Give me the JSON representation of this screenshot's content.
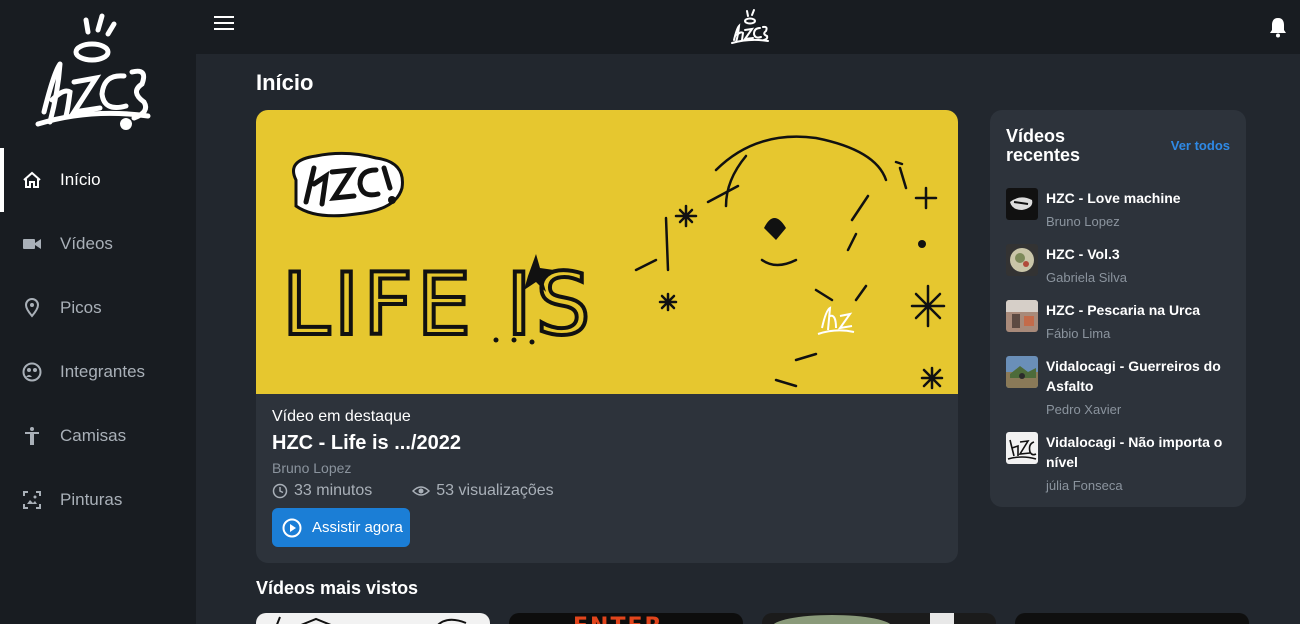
{
  "nav": {
    "items": [
      {
        "label": "Início",
        "icon": "home-icon"
      },
      {
        "label": "Vídeos",
        "icon": "video-camera-icon"
      },
      {
        "label": "Picos",
        "icon": "map-pin-icon"
      },
      {
        "label": "Integrantes",
        "icon": "group-icon"
      },
      {
        "label": "Camisas",
        "icon": "person-icon"
      },
      {
        "label": "Pinturas",
        "icon": "image-icon"
      }
    ]
  },
  "main": {
    "title": "Início",
    "featured": {
      "kicker": "Vídeo em destaque",
      "title": "HZC - Life is .../2022",
      "author": "Bruno Lopez",
      "duration": "33 minutos",
      "views": "53 visualizações",
      "cta": "Assistir agora",
      "art_text": "LIFE IS"
    },
    "recent": {
      "title": "Vídeos recentes",
      "see_all": "Ver todos",
      "items": [
        {
          "title": "HZC - Love machine",
          "author": "Bruno Lopez"
        },
        {
          "title": "HZC - Vol.3",
          "author": "Gabriela Silva"
        },
        {
          "title": "HZC - Pescaria na Urca",
          "author": "Fábio Lima"
        },
        {
          "title": "Vidalocagi - Guerreiros do Asfalto",
          "author": "Pedro Xavier"
        },
        {
          "title": "Vidalocagi - Não importa o nível",
          "author": "júlia Fonseca"
        }
      ]
    },
    "most_viewed": {
      "title": "Vídeos mais vistos",
      "thumb_text": "ENTER"
    }
  },
  "colors": {
    "accent": "#1b7ed6",
    "link": "#2f8ae6",
    "featured_bg": "#e6c72f"
  }
}
